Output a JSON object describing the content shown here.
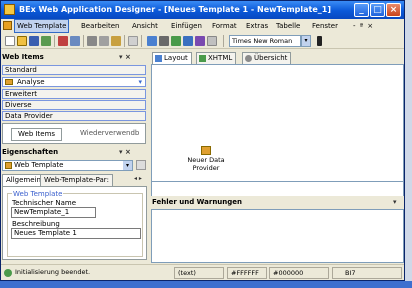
{
  "window": {
    "title": "BEx Web Application Designer - [Neues Template 1 - NewTemplate_1]",
    "controls": [
      "_",
      "□",
      "×"
    ]
  },
  "menu": {
    "items": [
      "Web Template",
      "Bearbeiten",
      "Ansicht",
      "Einfügen",
      "Format",
      "Extras",
      "Tabelle",
      "Fenster"
    ],
    "doc_controls": "- ª ×"
  },
  "toolbar": {
    "font_name": "Times New Roman"
  },
  "web_items": {
    "title": "Web Items",
    "controls": "▾ ×",
    "categories": [
      "Standard",
      "Analyse",
      "Erweitert",
      "Diverse",
      "Data Provider"
    ],
    "tabs": [
      "Web Items",
      "Wiederverwendb"
    ]
  },
  "properties": {
    "title": "Eigenschaften",
    "controls": "▾ ×",
    "selector": "Web Template",
    "tabs": [
      "Allgemein",
      "Web-Template-Par:"
    ],
    "group_title": "Web Template",
    "tech_name_label": "Technischer Name",
    "tech_name_value": "NewTemplate_1",
    "desc_label": "Beschreibung",
    "desc_value": "Neues Template 1"
  },
  "editor": {
    "tabs": [
      "Layout",
      "XHTML",
      "Übersicht"
    ],
    "new_dataprovider": "Neuer Data\nProvider"
  },
  "errors": {
    "title": "Fehler und Warnungen",
    "controls": "▾"
  },
  "status": {
    "message": "Initialisierung beendet.",
    "fields": [
      "(text)",
      "#FFFFFF",
      "#000000",
      "BI7"
    ]
  }
}
